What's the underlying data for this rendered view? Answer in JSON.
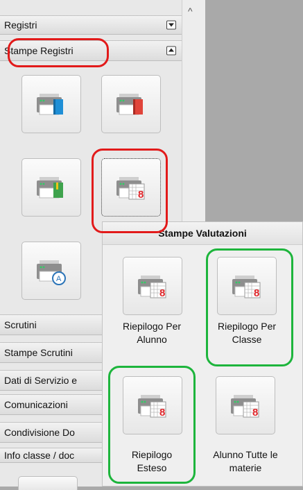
{
  "sidebar": {
    "sections": {
      "registri": "Registri",
      "stampe_registri": "Stampe Registri",
      "scrutini": "Scrutini",
      "stampe_scrutini": "Stampe Scrutini",
      "dati_servizio": "Dati di Servizio e",
      "comunicazioni": "Comunicazioni",
      "condivisione": "Condivisione Do",
      "info_classe": "Info classe / doc"
    }
  },
  "popup": {
    "title": "Stampe Valutazioni",
    "items": [
      {
        "label_line1": "Riepilogo Per",
        "label_line2": "Alunno"
      },
      {
        "label_line1": "Riepilogo Per",
        "label_line2": "Classe"
      },
      {
        "label_line1": "Riepilogo",
        "label_line2": "Esteso"
      },
      {
        "label_line1": "Alunno Tutte le",
        "label_line2": "materie"
      }
    ]
  },
  "colors": {
    "highlight_red": "#e21a1a",
    "highlight_green": "#1db53c"
  },
  "icons": {
    "printer": "printer-icon",
    "book_blue": "blue-book-icon",
    "book_red": "red-book-icon",
    "book_green": "green-book-icon",
    "grid_eight": "grade-grid-icon",
    "circle_a": "circle-a-icon"
  }
}
